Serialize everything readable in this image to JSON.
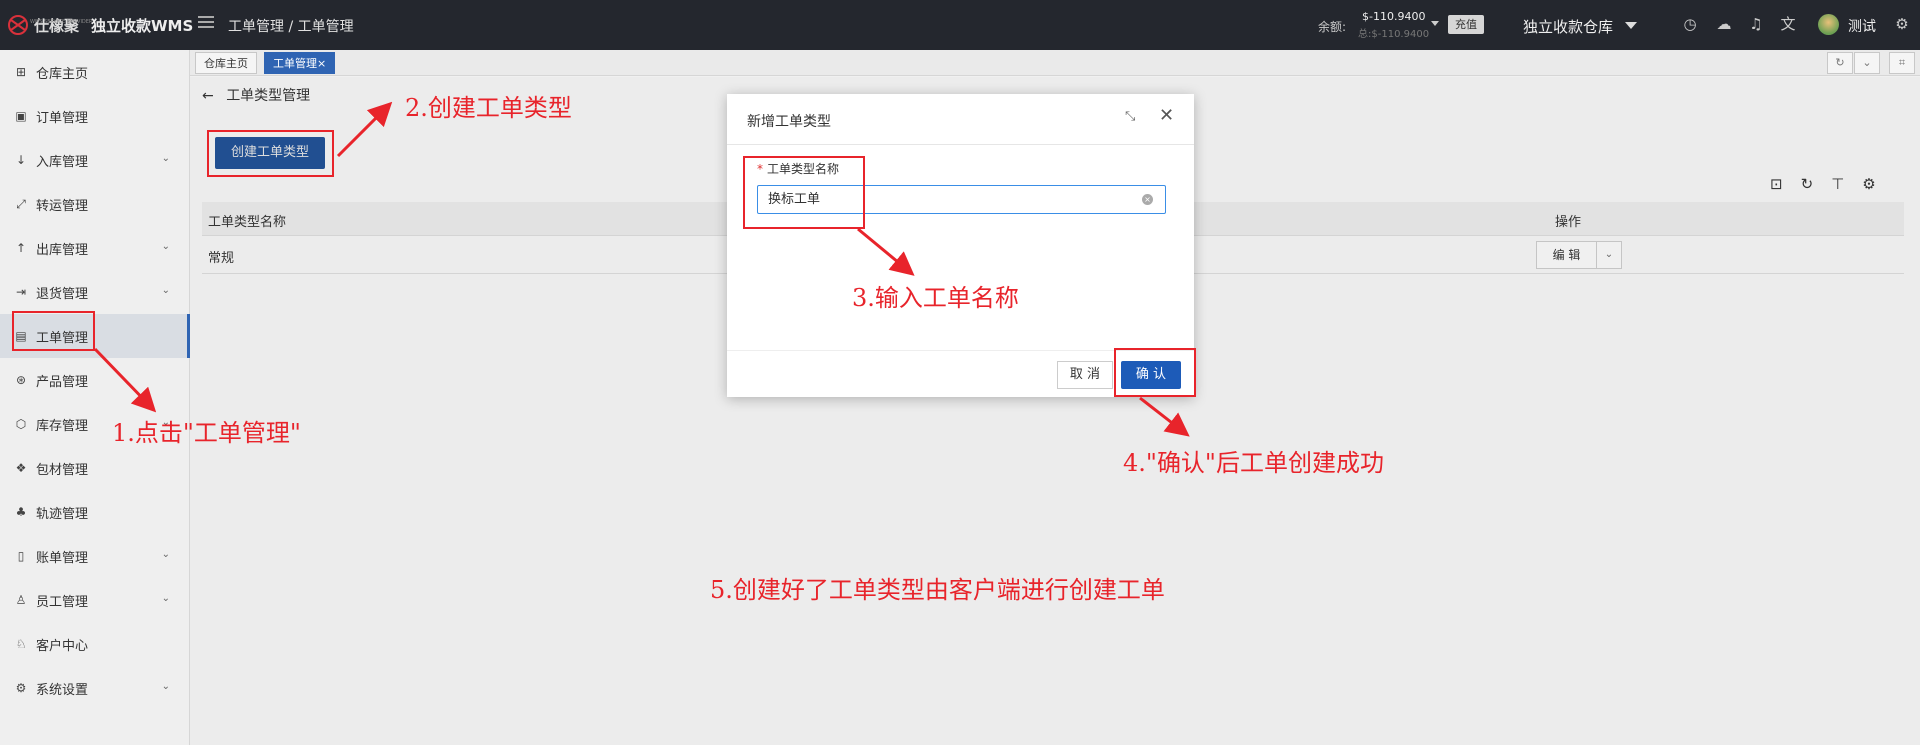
{
  "topbar": {
    "logo_text": "仕橡聚",
    "logo_sub": "WMS SERVICE PROVIDER",
    "app_name": "独立收款WMS",
    "breadcrumb": "工单管理 / 工单管理",
    "balance_label": "余额:",
    "balance_value": "$-110.9400",
    "balance_total": "总:$-110.9400",
    "recharge_label": "充值",
    "warehouse_name": "独立收款仓库",
    "user_name": "测试"
  },
  "sidebar": {
    "items": [
      {
        "label": "仓库主页",
        "icon": "grid-icon",
        "glyph": "⊞",
        "chevron": false
      },
      {
        "label": "订单管理",
        "icon": "order-icon",
        "glyph": "▣",
        "chevron": false
      },
      {
        "label": "入库管理",
        "icon": "arrow-down-icon",
        "glyph": "↓",
        "chevron": true
      },
      {
        "label": "转运管理",
        "icon": "transfer-icon",
        "glyph": "⤢",
        "chevron": false
      },
      {
        "label": "出库管理",
        "icon": "arrow-up-icon",
        "glyph": "↑",
        "chevron": true
      },
      {
        "label": "退货管理",
        "icon": "return-icon",
        "glyph": "⇥",
        "chevron": true
      },
      {
        "label": "工单管理",
        "icon": "workorder-icon",
        "glyph": "▤",
        "chevron": false,
        "active": true
      },
      {
        "label": "产品管理",
        "icon": "product-icon",
        "glyph": "⊛",
        "chevron": false
      },
      {
        "label": "库存管理",
        "icon": "inventory-icon",
        "glyph": "⬡",
        "chevron": true
      },
      {
        "label": "包材管理",
        "icon": "package-icon",
        "glyph": "❖",
        "chevron": false
      },
      {
        "label": "轨迹管理",
        "icon": "track-icon",
        "glyph": "♣",
        "chevron": false
      },
      {
        "label": "账单管理",
        "icon": "bill-icon",
        "glyph": "▯",
        "chevron": true
      },
      {
        "label": "员工管理",
        "icon": "user-icon",
        "glyph": "♙",
        "chevron": true
      },
      {
        "label": "客户中心",
        "icon": "customer-icon",
        "glyph": "♘",
        "chevron": false
      },
      {
        "label": "系统设置",
        "icon": "settings-icon",
        "glyph": "⚙",
        "chevron": true
      }
    ]
  },
  "tabs": [
    {
      "label": "仓库主页",
      "active": false
    },
    {
      "label": "工单管理",
      "active": true
    }
  ],
  "tab_close": "×",
  "page": {
    "back_title": "工单类型管理",
    "create_button": "创建工单类型",
    "table": {
      "col_name": "工单类型名称",
      "col_action": "操作",
      "rows": [
        {
          "name": "常规",
          "edit": "编 辑"
        }
      ]
    }
  },
  "modal": {
    "title": "新增工单类型",
    "required_mark": "*",
    "field_label": "工单类型名称",
    "field_value": "换标工单",
    "cancel": "取 消",
    "confirm": "确 认"
  },
  "annotations": {
    "step1": "1.点击\"工单管理\"",
    "step2": "2.创建工单类型",
    "step3": "3.输入工单名称",
    "step4": "4.\"确认\"后工单创建成功",
    "step5": "5.创建好了工单类型由客户端进行创建工单",
    "color": "#e8242b"
  }
}
